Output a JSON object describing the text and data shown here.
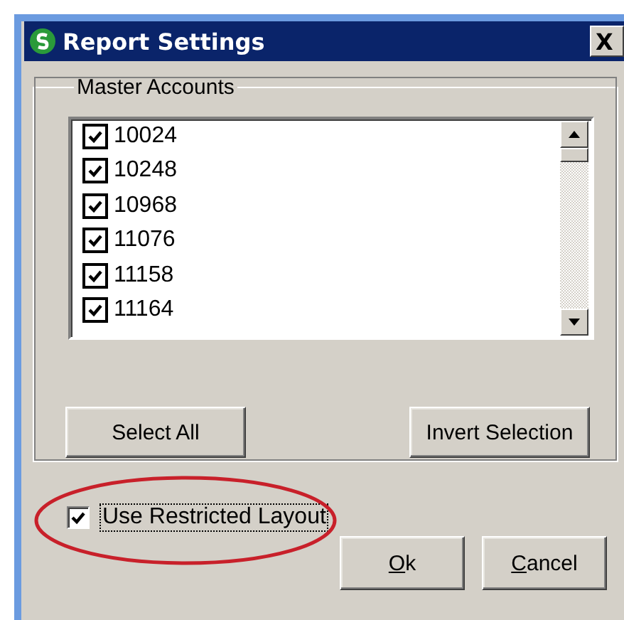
{
  "window": {
    "title": "Report Settings",
    "close": "X"
  },
  "group": {
    "title": "Master Accounts",
    "accounts": [
      {
        "label": "10024",
        "checked": true
      },
      {
        "label": "10248",
        "checked": true
      },
      {
        "label": "10968",
        "checked": true
      },
      {
        "label": "11076",
        "checked": true
      },
      {
        "label": "11158",
        "checked": true
      },
      {
        "label": "11164",
        "checked": true
      }
    ],
    "buttons": [
      "Select All",
      "Invert Selection"
    ]
  },
  "restricted_layout": {
    "label": "Use Restricted Layout",
    "checked": true,
    "focused": true
  },
  "footer_buttons": [
    {
      "label": "Ok",
      "mnemonic_underlined": true
    },
    {
      "label": "Cancel",
      "mnemonic_underlined": true
    }
  ]
}
